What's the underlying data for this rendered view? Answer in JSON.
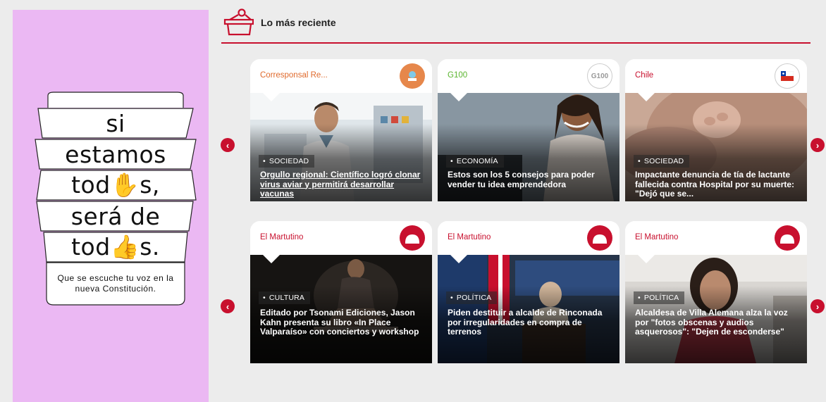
{
  "banner": {
    "lines": [
      "si",
      "estamos",
      "tod✋s,",
      "será de",
      "tod👍s."
    ],
    "note": "Que se escuche tu voz en la nueva Constitución.",
    "background": "#ebb8f3"
  },
  "section": {
    "title": "Lo más reciente",
    "accent": "#c8102e",
    "icon": "basket-icon"
  },
  "arrows": {
    "prev": "‹",
    "next": "›"
  },
  "rows": [
    {
      "cards": [
        {
          "source": "Corresponsal Re...",
          "source_color": "#e06a2c",
          "logo": "corresponsal-logo-icon",
          "tag": "SOCIEDAD",
          "headline": "Orgullo regional: Científico logró clonar virus aviar y permitirá desarrollar vacunas"
        },
        {
          "source": "G100",
          "source_color": "#5ab52e",
          "logo": "g100-logo-icon",
          "logo_text": "G100",
          "tag": "ECONOMÍA",
          "headline": "Estos son los 5 consejos para poder vender tu idea emprendedora"
        },
        {
          "source": "Chile",
          "source_color": "#c8102e",
          "logo": "chile-flag-icon",
          "tag": "SOCIEDAD",
          "headline": "Impactante denuncia de tía de lactante fallecida contra Hospital por su muerte: \"Dejó que se..."
        }
      ]
    },
    {
      "cards": [
        {
          "source": "El Martutino",
          "source_color": "#c8102e",
          "logo": "el-martutino-logo-icon",
          "tag": "CULTURA",
          "headline": "Editado por Tsonami Ediciones, Jason Kahn presenta su libro «In Place Valparaíso» con conciertos y workshop"
        },
        {
          "source": "El Martutino",
          "source_color": "#c8102e",
          "logo": "el-martutino-logo-icon",
          "tag": "POLÍTICA",
          "headline": "Piden destituir a alcalde de Rinconada por irregularidades en compra de terrenos"
        },
        {
          "source": "El Martutino",
          "source_color": "#c8102e",
          "logo": "el-martutino-logo-icon",
          "tag": "POLÍTICA",
          "headline": "Alcaldesa de Villa Alemana alza la voz por \"fotos obscenas y audios asquerosos\": \"Dejen de esconderse\""
        }
      ]
    }
  ]
}
